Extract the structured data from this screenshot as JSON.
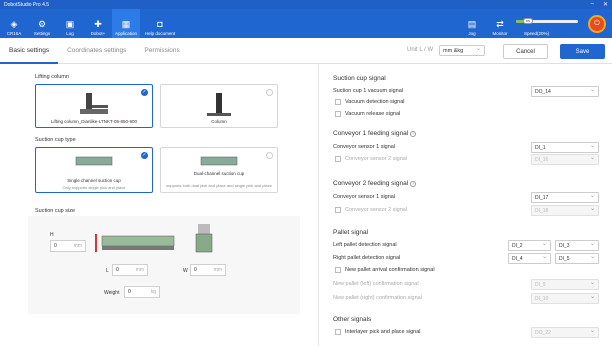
{
  "window": {
    "title": "DobotStudio Pro 4.5",
    "controls": [
      "–",
      "✕"
    ]
  },
  "toolbar": {
    "items": [
      {
        "label": "CR16A",
        "icon": "robot-icon"
      },
      {
        "label": "Settings",
        "icon": "gear-icon"
      },
      {
        "label": "Log",
        "icon": "log-icon"
      },
      {
        "label": "Dobot+",
        "icon": "puzzle-icon"
      },
      {
        "label": "Application",
        "icon": "application-icon"
      },
      {
        "label": "Help document",
        "icon": "document-icon"
      }
    ],
    "right": [
      {
        "label": "Jog",
        "icon": "jog-icon"
      },
      {
        "label": "Monitor",
        "icon": "monitor-icon"
      }
    ],
    "speed_label": "Speed(20%)",
    "speed_value": 20,
    "speed_knob": "ON"
  },
  "tabs": [
    "Basic settings",
    "Coordinates settings",
    "Permissions"
  ],
  "unit": {
    "label": "Unit L / W",
    "value": "mm &kg"
  },
  "buttons": {
    "cancel": "Cancel",
    "save": "Save"
  },
  "lifting": {
    "title": "Lifting column",
    "options": [
      {
        "label": "Lifting column_Dianlike-LTNKT-05-850-900",
        "selected": true
      },
      {
        "label": "Column",
        "selected": false
      }
    ]
  },
  "suction_type": {
    "title": "Suction cup type",
    "options": [
      {
        "label": "Single channel suction cup",
        "desc": "Only supports single pick and place",
        "selected": true
      },
      {
        "label": "Dual-channel suction cup",
        "desc": "supports both dual pick and place and single pick and place",
        "selected": false
      }
    ]
  },
  "suction_size": {
    "title": "Suction cup size",
    "h_label": "H",
    "h_value": "0",
    "h_unit": "mm",
    "l_label": "L",
    "l_value": "0",
    "l_unit": "mm",
    "w_label": "W",
    "w_value": "0",
    "w_unit": "mm",
    "weight_label": "Weight",
    "weight_value": "0",
    "weight_unit": "kg"
  },
  "right": {
    "suction_signal": {
      "title": "Suction cup signal",
      "rows": [
        {
          "label": "Suction cup 1 vacuum signal",
          "value": "DO_14"
        },
        {
          "label": "Vacuum detection signal"
        },
        {
          "label": "Vacuum release signal"
        }
      ]
    },
    "conveyor1": {
      "title": "Conveyor 1 feeding signal",
      "rows": [
        {
          "label": "Conveyor sensor 1 signal",
          "value": "DI_1"
        },
        {
          "label": "Conveyor sensor 2 signal",
          "value": "DI_16"
        }
      ]
    },
    "conveyor2": {
      "title": "Conveyor 2 feeding signal",
      "rows": [
        {
          "label": "Conveyor sensor 1 signal",
          "value": "DI_17"
        },
        {
          "label": "Conveyor sensor 2 signal",
          "value": "DI_18"
        }
      ]
    },
    "pallet": {
      "title": "Pallet signal",
      "rows": [
        {
          "label": "Left pallet detection signal",
          "v1": "DI_2",
          "v2": "DI_3"
        },
        {
          "label": "Right pallet detection signal",
          "v1": "DI_4",
          "v2": "DI_5"
        },
        {
          "label": "New pallet arrival confirmation signal"
        },
        {
          "label": "New pallet (left) confirmation signal",
          "value": "DI_9"
        },
        {
          "label": "New pallet (right) confirmation signal",
          "value": "DI_10"
        }
      ]
    },
    "other": {
      "title": "Other signals",
      "rows": [
        {
          "label": "Interlayer pick and place signal",
          "value": "DO_22"
        }
      ]
    }
  }
}
